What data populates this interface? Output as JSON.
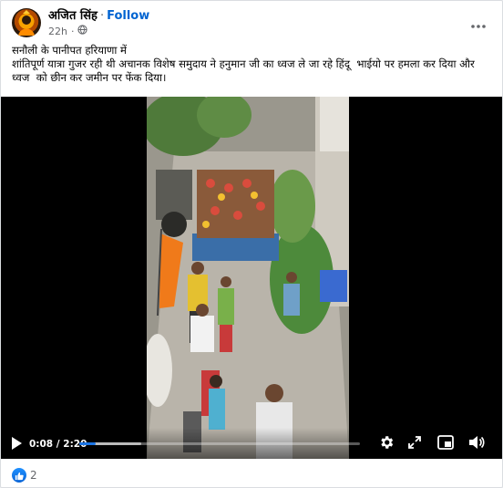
{
  "post": {
    "author": "अजित सिंह",
    "separator": "·",
    "follow_label": "Follow",
    "time": "22h",
    "audience_icon": "globe-icon",
    "more_icon": "more-dots-icon",
    "text_line1": "सनौली के पानीपत हरियाणा में",
    "text_body": "शांतिपूर्ण यात्रा गुजर रही थी अचानक विशेष समुदाय ने हनुमान जी का ध्वज ले जा रहे हिंदू  भाईयो पर हमला कर दिया और ध्वज  को छीन कर जमीन पर फेंक दिया।"
  },
  "video": {
    "current_time": "0:08",
    "duration": "2:20",
    "time_separator": " / ",
    "progress_fraction": 0.057,
    "buffered_fraction": 0.22,
    "accent_color": "#1b74e4",
    "icons": [
      "play-icon",
      "settings-gear-icon",
      "expand-icon",
      "picture-in-picture-icon",
      "volume-icon"
    ]
  },
  "reactions": {
    "icon": "like-icon",
    "count": "2"
  }
}
